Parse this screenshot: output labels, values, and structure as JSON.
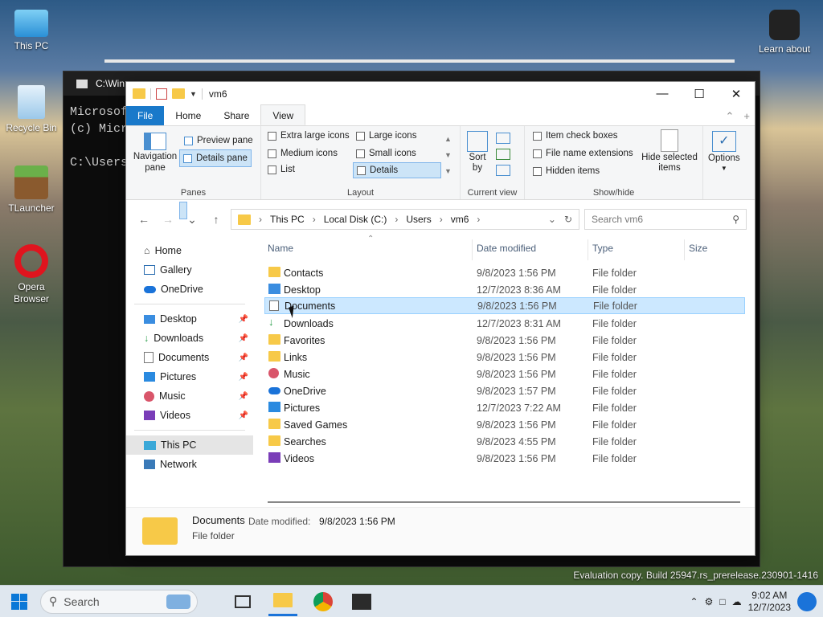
{
  "desktop": {
    "icons": [
      {
        "label": "This PC"
      },
      {
        "label": "Recycle Bin"
      },
      {
        "label": "TLauncher"
      },
      {
        "label": "Opera Browser"
      }
    ],
    "learn_about": "Learn about",
    "watermark": "Evaluation copy. Build 25947.rs_prerelease.230901-1416"
  },
  "console": {
    "title": "C:\\Win",
    "lines": [
      "Microsof",
      "(c) Micr",
      "",
      "C:\\Users"
    ]
  },
  "explorer": {
    "title": "vm6",
    "tabs": [
      {
        "label": "File"
      },
      {
        "label": "Home"
      },
      {
        "label": "Share"
      },
      {
        "label": "View"
      }
    ],
    "ribbon": {
      "panes": {
        "label": "Panes",
        "navigation_pane": "Navigation",
        "navigation_pane2": "pane",
        "preview_pane": "Preview pane",
        "details_pane": "Details pane"
      },
      "layout": {
        "label": "Layout",
        "items": [
          "Extra large icons",
          "Large icons",
          "Medium icons",
          "Small icons",
          "List",
          "Details"
        ]
      },
      "current_view": {
        "label": "Current view",
        "sort_by": "Sort",
        "sort_by2": "by"
      },
      "show_hide": {
        "label": "Show/hide",
        "item_check_boxes": "Item check boxes",
        "file_name_extensions": "File name extensions",
        "hidden_items": "Hidden items",
        "hide_selected": "Hide selected",
        "hide_selected2": "items"
      },
      "options": "Options"
    },
    "address": {
      "segments": [
        "This PC",
        "Local Disk (C:)",
        "Users",
        "vm6"
      ],
      "search_placeholder": "Search vm6"
    },
    "nav": {
      "top": [
        {
          "label": "Home"
        },
        {
          "label": "Gallery"
        },
        {
          "label": "OneDrive"
        }
      ],
      "pinned": [
        {
          "label": "Desktop"
        },
        {
          "label": "Downloads"
        },
        {
          "label": "Documents"
        },
        {
          "label": "Pictures"
        },
        {
          "label": "Music"
        },
        {
          "label": "Videos"
        }
      ],
      "bottom": [
        {
          "label": "This PC"
        },
        {
          "label": "Network"
        }
      ]
    },
    "columns": {
      "name": "Name",
      "date": "Date modified",
      "type": "Type",
      "size": "Size"
    },
    "files": [
      {
        "name": "Contacts",
        "date": "9/8/2023 1:56 PM",
        "type": "File folder"
      },
      {
        "name": "Desktop",
        "date": "12/7/2023 8:36 AM",
        "type": "File folder"
      },
      {
        "name": "Documents",
        "date": "9/8/2023 1:56 PM",
        "type": "File folder"
      },
      {
        "name": "Downloads",
        "date": "12/7/2023 8:31 AM",
        "type": "File folder"
      },
      {
        "name": "Favorites",
        "date": "9/8/2023 1:56 PM",
        "type": "File folder"
      },
      {
        "name": "Links",
        "date": "9/8/2023 1:56 PM",
        "type": "File folder"
      },
      {
        "name": "Music",
        "date": "9/8/2023 1:56 PM",
        "type": "File folder"
      },
      {
        "name": "OneDrive",
        "date": "9/8/2023 1:57 PM",
        "type": "File folder"
      },
      {
        "name": "Pictures",
        "date": "12/7/2023 7:22 AM",
        "type": "File folder"
      },
      {
        "name": "Saved Games",
        "date": "9/8/2023 1:56 PM",
        "type": "File folder"
      },
      {
        "name": "Searches",
        "date": "9/8/2023 4:55 PM",
        "type": "File folder"
      },
      {
        "name": "Videos",
        "date": "9/8/2023 1:56 PM",
        "type": "File folder"
      }
    ],
    "details": {
      "name": "Documents",
      "date_label": "Date modified:",
      "date": "9/8/2023 1:56 PM",
      "type": "File folder"
    }
  },
  "taskbar": {
    "search_placeholder": "Search",
    "time": "9:02 AM",
    "date": "12/7/2023"
  }
}
